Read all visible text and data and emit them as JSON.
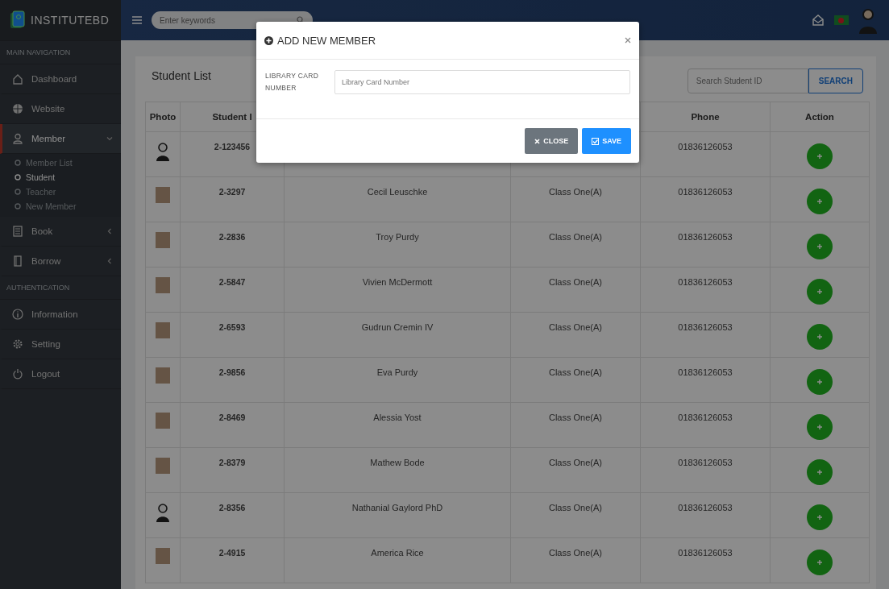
{
  "brand": {
    "name": "INSTITUTEBD"
  },
  "topbar": {
    "search": {
      "placeholder": "Enter keywords"
    }
  },
  "sidebar": {
    "items": [
      {
        "kind": "section",
        "label": "MAIN NAVIGATION"
      },
      {
        "kind": "link",
        "label": "Dashboard",
        "selected": false
      },
      {
        "kind": "link",
        "label": "Website",
        "selected": false
      },
      {
        "kind": "menu",
        "label": "Member",
        "selected": true,
        "expanded": true,
        "children": [
          {
            "label": "Member List",
            "selected": false
          },
          {
            "label": "Student",
            "selected": true
          },
          {
            "label": "Teacher",
            "selected": false
          },
          {
            "label": "New Member",
            "selected": false
          }
        ]
      },
      {
        "kind": "menu",
        "label": "Book",
        "selected": false,
        "expanded": false
      },
      {
        "kind": "menu",
        "label": "Borrow",
        "selected": false,
        "expanded": false
      },
      {
        "kind": "section",
        "label": "AUTHENTICATION"
      },
      {
        "kind": "link",
        "label": "Information",
        "selected": false
      },
      {
        "kind": "link",
        "label": "Setting",
        "selected": false
      },
      {
        "kind": "link",
        "label": "Logout",
        "selected": false
      }
    ]
  },
  "student_list": {
    "title": "Student List",
    "search": {
      "placeholder": "Search Student ID",
      "button": "SEARCH"
    },
    "header": {
      "photo": "Photo",
      "student_id": "Student I",
      "phone": "Phone",
      "action": "Action"
    },
    "rows": [
      {
        "photo": {
          "kind": "avatar"
        },
        "student_id": "2-123456",
        "phone": "01836126053"
      },
      {
        "photo": {
          "kind": "photo"
        },
        "student_id": "2-3297",
        "name": "Cecil Leuschke",
        "class": "Class One(A)",
        "phone": "01836126053"
      },
      {
        "photo": {
          "kind": "photo"
        },
        "student_id": "2-2836",
        "name": "Troy Purdy",
        "class": "Class One(A)",
        "phone": "01836126053"
      },
      {
        "photo": {
          "kind": "photo"
        },
        "student_id": "2-5847",
        "name": "Vivien McDermott",
        "class": "Class One(A)",
        "phone": "01836126053"
      },
      {
        "photo": {
          "kind": "photo"
        },
        "student_id": "2-6593",
        "name": "Gudrun Cremin IV",
        "class": "Class One(A)",
        "phone": "01836126053"
      },
      {
        "photo": {
          "kind": "photo"
        },
        "student_id": "2-9856",
        "name": "Eva Purdy",
        "class": "Class One(A)",
        "phone": "01836126053"
      },
      {
        "photo": {
          "kind": "photo"
        },
        "student_id": "2-8469",
        "name": "Alessia Yost",
        "class": "Class One(A)",
        "phone": "01836126053"
      },
      {
        "photo": {
          "kind": "photo"
        },
        "student_id": "2-8379",
        "name": "Mathew Bode",
        "class": "Class One(A)",
        "phone": "01836126053"
      },
      {
        "photo": {
          "kind": "avatar"
        },
        "student_id": "2-8356",
        "name": "Nathanial Gaylord PhD",
        "class": "Class One(A)",
        "phone": "01836126053"
      },
      {
        "photo": {
          "kind": "photo"
        },
        "student_id": "2-4915",
        "name": "America Rice",
        "class": "Class One(A)",
        "phone": "01836126053"
      }
    ]
  },
  "modal": {
    "title": "ADD NEW MEMBER",
    "field_label": "LIBRARY CARD NUMBER",
    "field": {
      "placeholder": "Library Card Number"
    },
    "buttons": [
      {
        "kind": "close",
        "label": "CLOSE"
      },
      {
        "kind": "save",
        "label": "SAVE"
      }
    ]
  }
}
